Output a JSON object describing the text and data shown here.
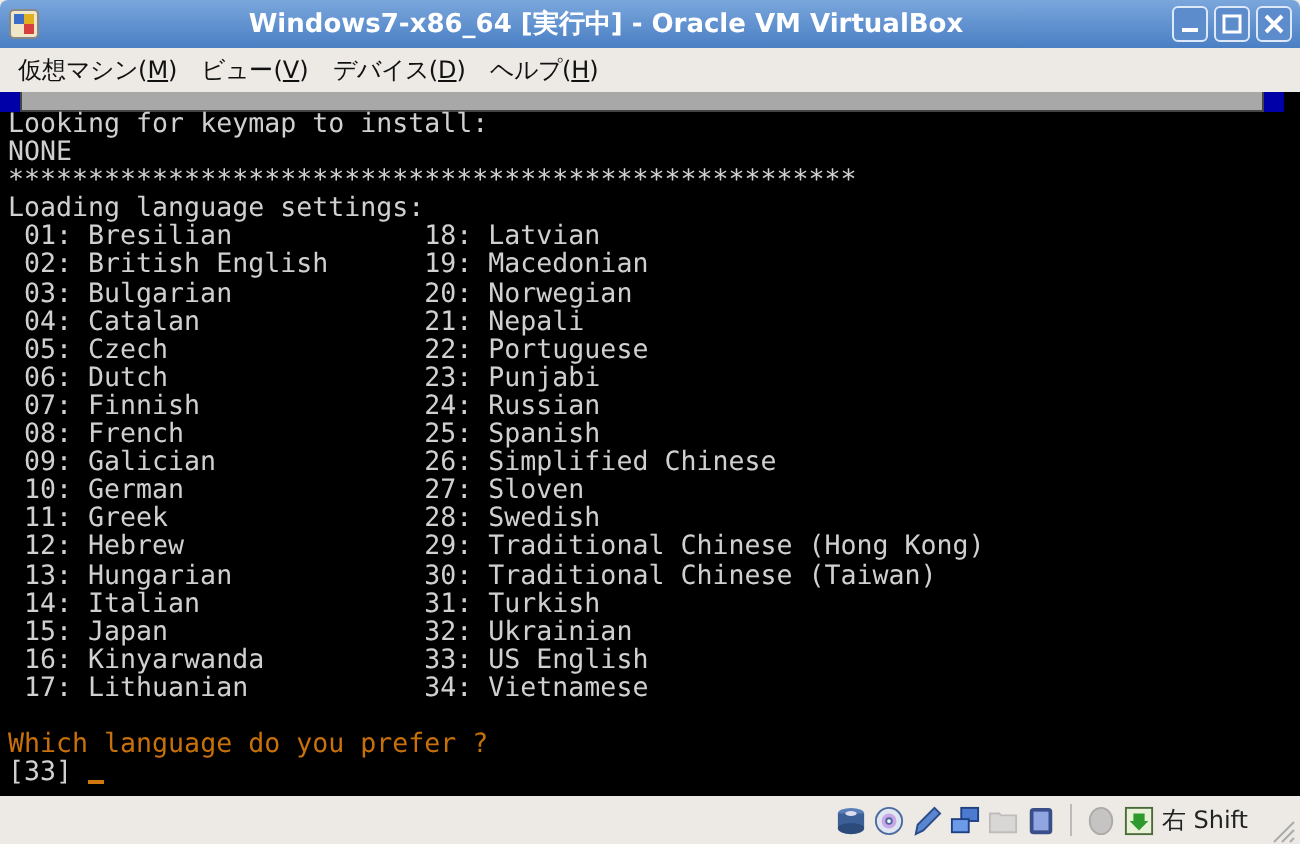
{
  "window": {
    "title": "Windows7-x86_64 [実行中] - Oracle VM VirtualBox"
  },
  "menu": [
    {
      "before": "仮想マシン(",
      "mnemonic": "M",
      "after": ")"
    },
    {
      "before": "ビュー(",
      "mnemonic": "V",
      "after": ")"
    },
    {
      "before": "デバイス(",
      "mnemonic": "D",
      "after": ")"
    },
    {
      "before": "ヘルプ(",
      "mnemonic": "H",
      "after": ")"
    }
  ],
  "console": {
    "lines": [
      {
        "kind": "text",
        "text": "Looking for keymap to install:"
      },
      {
        "kind": "text",
        "text": "NONE"
      },
      {
        "kind": "text",
        "text": "*****************************************************"
      },
      {
        "kind": "text",
        "text": "Loading language settings:"
      }
    ],
    "languages": [
      {
        "number": "01:",
        "name": "Bresilian"
      },
      {
        "number": "02:",
        "name": "British English"
      },
      {
        "number": "03:",
        "name": "Bulgarian"
      },
      {
        "number": "04:",
        "name": "Catalan"
      },
      {
        "number": "05:",
        "name": "Czech"
      },
      {
        "number": "06:",
        "name": "Dutch"
      },
      {
        "number": "07:",
        "name": "Finnish"
      },
      {
        "number": "08:",
        "name": "French"
      },
      {
        "number": "09:",
        "name": "Galician"
      },
      {
        "number": "10:",
        "name": "German"
      },
      {
        "number": "11:",
        "name": "Greek"
      },
      {
        "number": "12:",
        "name": "Hebrew"
      },
      {
        "number": "13:",
        "name": "Hungarian"
      },
      {
        "number": "14:",
        "name": "Italian"
      },
      {
        "number": "15:",
        "name": "Japan"
      },
      {
        "number": "16:",
        "name": "Kinyarwanda"
      },
      {
        "number": "17:",
        "name": "Lithuanian"
      },
      {
        "number": "18:",
        "name": "Latvian"
      },
      {
        "number": "19:",
        "name": "Macedonian"
      },
      {
        "number": "20:",
        "name": "Norwegian"
      },
      {
        "number": "21:",
        "name": "Nepali"
      },
      {
        "number": "22:",
        "name": "Portuguese"
      },
      {
        "number": "23:",
        "name": "Punjabi"
      },
      {
        "number": "24:",
        "name": "Russian"
      },
      {
        "number": "25:",
        "name": "Spanish"
      },
      {
        "number": "26:",
        "name": "Simplified Chinese"
      },
      {
        "number": "27:",
        "name": "Sloven"
      },
      {
        "number": "28:",
        "name": "Swedish"
      },
      {
        "number": "29:",
        "name": "Traditional Chinese (Hong Kong)"
      },
      {
        "number": "30:",
        "name": "Traditional Chinese (Taiwan)"
      },
      {
        "number": "31:",
        "name": "Turkish"
      },
      {
        "number": "32:",
        "name": "Ukrainian"
      },
      {
        "number": "33:",
        "name": "US English"
      },
      {
        "number": "34:",
        "name": "Vietnamese"
      }
    ],
    "prompt": "Which language do you prefer ?",
    "input": "[33]"
  },
  "status_bar": {
    "devices": [
      {
        "kind": "disk",
        "disabled": false
      },
      {
        "kind": "cd",
        "disabled": false
      },
      {
        "kind": "usb",
        "disabled": false
      },
      {
        "kind": "network",
        "disabled": false
      },
      {
        "kind": "folder",
        "disabled": true
      },
      {
        "kind": "vt",
        "disabled": false
      },
      {
        "kind": "mouse",
        "disabled": true
      },
      {
        "kind": "capture",
        "disabled": false
      }
    ],
    "host_key": "右 Shift"
  }
}
